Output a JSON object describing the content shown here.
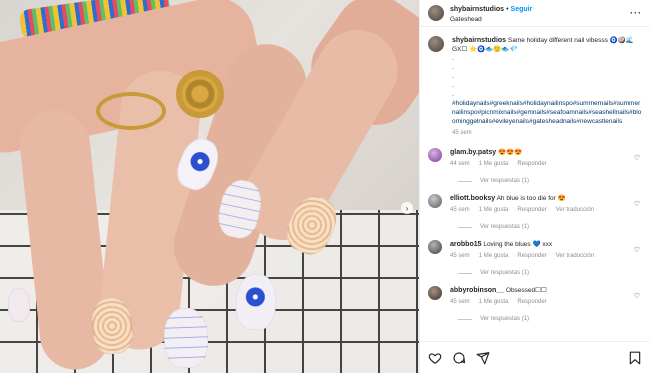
{
  "post": {
    "username": "shybairnstudios",
    "follow_label": "Seguir",
    "location": "Gateshead",
    "caption_text": "Same holiday different nail vibesss 🧿🥥🌊GX☐ ⭐🧿🐟🙂🐟💎",
    "caption_dots": [
      ".",
      ".",
      ".",
      ".",
      "."
    ],
    "hashtags": "#holidaynails#greeknails#holidaynailinspo#summernails#summernailinspo#picnmixnails#gemnails#seafoamnails#seashellnails#bloominggelnails#evileyenails#gatesheadnails#newcastlenails",
    "time": "45 sem"
  },
  "comments": [
    {
      "user": "glam.by.patsy",
      "text": "😍😍😍",
      "time": "44 sem",
      "likes": "1 Me gusta",
      "reply": "Responder",
      "translate": "",
      "replies": "Ver respuestas (1)"
    },
    {
      "user": "elliott.booksy",
      "text": "Ah blue is too die for 😍",
      "time": "45 sem",
      "likes": "1 Me gusta",
      "reply": "Responder",
      "translate": "Ver traducción",
      "replies": "Ver respuestas (1)"
    },
    {
      "user": "arobbo15",
      "text": "Loving the blues 💙 xxx",
      "time": "45 sem",
      "likes": "1 Me gusta",
      "reply": "Responder",
      "translate": "Ver traducción",
      "replies": "Ver respuestas (1)"
    },
    {
      "user": "abbyrobinson__",
      "text": "Obsessed☐☐",
      "time": "45 sem",
      "likes": "1 Me gusta",
      "reply": "Responder",
      "translate": "",
      "replies": "Ver respuestas (1)"
    }
  ],
  "icons": {
    "more": "more-icon",
    "heart": "heart-icon",
    "comment": "comment-icon",
    "share": "share-icon",
    "bookmark": "bookmark-icon",
    "next": "chevron-right-icon"
  },
  "colors": {
    "link": "#0095f6",
    "hashtag": "#00376b",
    "muted": "#8e8e8e"
  }
}
